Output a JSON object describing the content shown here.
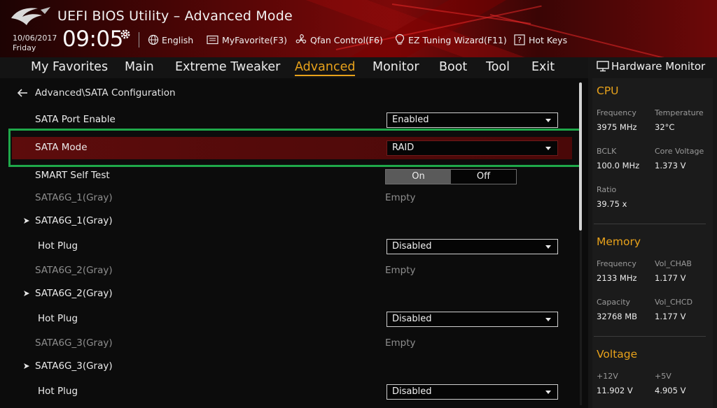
{
  "header": {
    "title": "UEFI BIOS Utility – Advanced Mode",
    "date": "10/06/2017",
    "day": "Friday",
    "time": "09:05",
    "toolbar": [
      {
        "label": "English",
        "icon": "globe-icon"
      },
      {
        "label": "MyFavorite(F3)",
        "icon": "favorite-icon"
      },
      {
        "label": "Qfan Control(F6)",
        "icon": "fan-icon"
      },
      {
        "label": "EZ Tuning Wizard(F11)",
        "icon": "bulb-icon"
      },
      {
        "label": "Hot Keys",
        "icon": "hotkeys-icon"
      }
    ]
  },
  "menu": {
    "tabs": [
      "My Favorites",
      "Main",
      "Extreme Tweaker",
      "Advanced",
      "Monitor",
      "Boot",
      "Tool",
      "Exit"
    ],
    "active": "Advanced"
  },
  "main": {
    "breadcrumb": "Advanced\\SATA Configuration",
    "sata_port_enable": {
      "label": "SATA Port Enable",
      "value": "Enabled"
    },
    "sata_mode": {
      "label": "SATA Mode",
      "value": "RAID"
    },
    "smart_self_test": {
      "label": "SMART Self Test",
      "on": "On",
      "off": "Off",
      "selected": "On"
    },
    "ports": [
      {
        "info_label": "SATA6G_1(Gray)",
        "info_value": "Empty",
        "group_label": "SATA6G_1(Gray)",
        "hotplug_label": "Hot Plug",
        "hotplug_value": "Disabled"
      },
      {
        "info_label": "SATA6G_2(Gray)",
        "info_value": "Empty",
        "group_label": "SATA6G_2(Gray)",
        "hotplug_label": "Hot Plug",
        "hotplug_value": "Disabled"
      },
      {
        "info_label": "SATA6G_3(Gray)",
        "info_value": "Empty",
        "group_label": "SATA6G_3(Gray)",
        "hotplug_label": "Hot Plug",
        "hotplug_value": "Disabled"
      }
    ]
  },
  "hardware_monitor": {
    "title": "Hardware Monitor",
    "cpu": {
      "title": "CPU",
      "frequency_label": "Frequency",
      "frequency": "3975 MHz",
      "temperature_label": "Temperature",
      "temperature": "32°C",
      "bclk_label": "BCLK",
      "bclk": "100.0 MHz",
      "core_voltage_label": "Core Voltage",
      "core_voltage": "1.373 V",
      "ratio_label": "Ratio",
      "ratio": "39.75 x"
    },
    "memory": {
      "title": "Memory",
      "frequency_label": "Frequency",
      "frequency": "2133 MHz",
      "vol_chab_label": "Vol_CHAB",
      "vol_chab": "1.177 V",
      "capacity_label": "Capacity",
      "capacity": "32768 MB",
      "vol_chcd_label": "Vol_CHCD",
      "vol_chcd": "1.177 V"
    },
    "voltage": {
      "title": "Voltage",
      "v12_label": "+12V",
      "v12": "11.902 V",
      "v5_label": "+5V",
      "v5": "4.905 V"
    }
  },
  "colors": {
    "accent": "#e8a21b",
    "highlight_box": "#1fa84a",
    "selected_row": "#5d0c0c"
  }
}
